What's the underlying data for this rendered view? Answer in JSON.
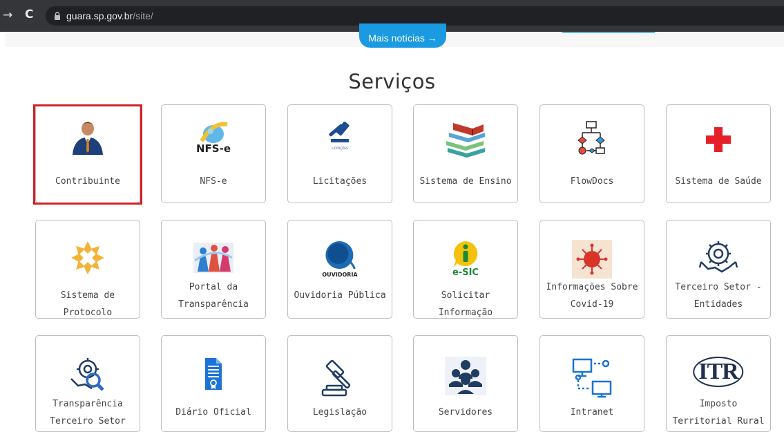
{
  "browser": {
    "url_host": "guara.sp.gov.br",
    "url_path": "/site/"
  },
  "news": {
    "more_label": "Mais notícias →"
  },
  "section_title": "Serviços",
  "services": [
    {
      "label": "Contribuinte",
      "icon": "person-icon"
    },
    {
      "label": "NFS-e",
      "icon": "nfse-logo-icon",
      "icon_text": "NFS-e"
    },
    {
      "label": "Licitações",
      "icon": "gavel-icon",
      "icon_text": "LICITAÇÕES"
    },
    {
      "label": "Sistema de Ensino",
      "icon": "books-icon"
    },
    {
      "label": "FlowDocs",
      "icon": "flowchart-icon"
    },
    {
      "label": "Sistema de Saúde",
      "icon": "red-cross-icon"
    },
    {
      "label": "Sistema de Protocolo",
      "icon": "protocol-star-icon"
    },
    {
      "label": "Portal da Transparência",
      "icon": "people-banner-icon"
    },
    {
      "label": "Ouvidoria Pública",
      "icon": "ouvidoria-logo-icon",
      "icon_text": "OUVIDORIA"
    },
    {
      "label": "Solicitar Informação",
      "icon": "esic-logo-icon",
      "icon_text": "e-SIC"
    },
    {
      "label": "Informações Sobre Covid-19",
      "icon": "virus-icon"
    },
    {
      "label": "Terceiro Setor - Entidades",
      "icon": "handshake-gear-icon"
    },
    {
      "label": "Transparência Terceiro Setor",
      "icon": "gear-magnifier-icon"
    },
    {
      "label": "Diário Oficial",
      "icon": "document-icon"
    },
    {
      "label": "Legislação",
      "icon": "gavel-outline-icon"
    },
    {
      "label": "Servidores",
      "icon": "group-icon"
    },
    {
      "label": "Intranet",
      "icon": "network-computers-icon"
    },
    {
      "label": "Imposto Territorial Rural",
      "icon": "itr-logo-icon",
      "icon_text": "ITR"
    }
  ],
  "colors": {
    "accent": "#1a9ae0",
    "selection": "#d32027",
    "browser_bar": "#35363a"
  }
}
